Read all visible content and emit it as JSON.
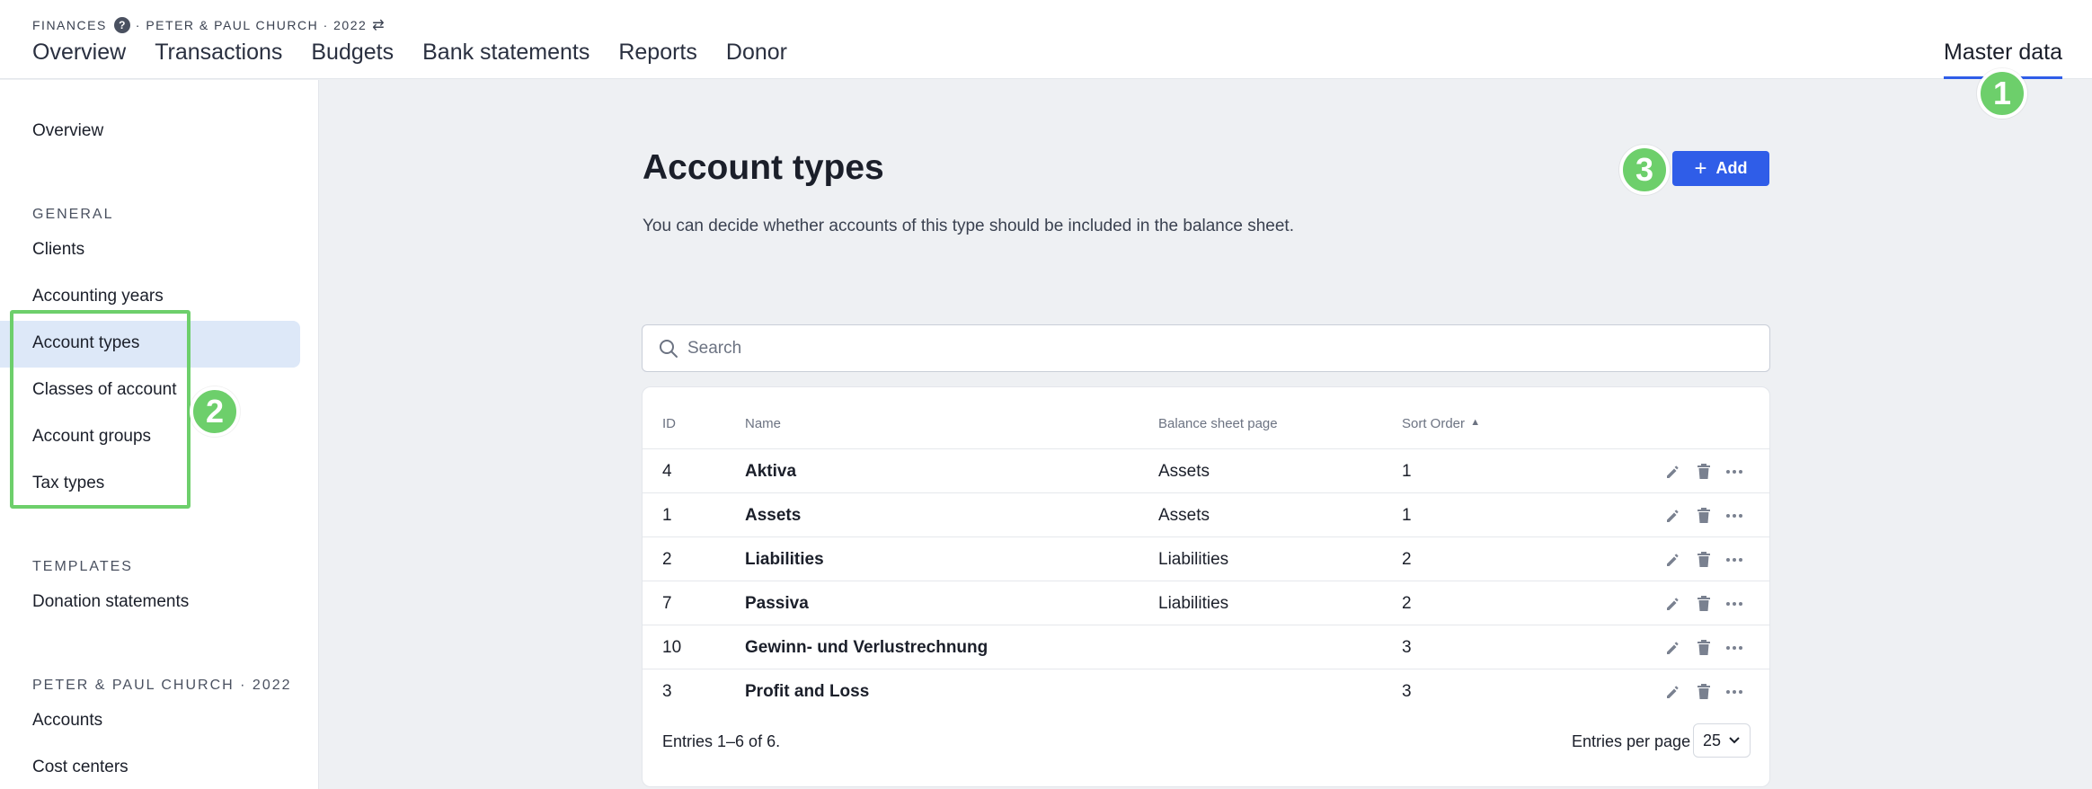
{
  "header": {
    "breadcrumb_app": "FINANCES",
    "breadcrumb_help": "?",
    "breadcrumb_context": "· PETER & PAUL CHURCH · 2022",
    "nav": [
      "Overview",
      "Transactions",
      "Budgets",
      "Bank statements",
      "Reports",
      "Donor"
    ],
    "master_data": "Master data"
  },
  "callouts": [
    "1",
    "2",
    "3"
  ],
  "sidebar": {
    "overview": "Overview",
    "general_heading": "GENERAL",
    "general_items": [
      "Clients",
      "Accounting years",
      "Account types",
      "Classes of account",
      "Account groups",
      "Tax types"
    ],
    "active_item": "Account types",
    "templates_heading": "TEMPLATES",
    "templates_items": [
      "Donation statements"
    ],
    "org_heading": "PETER & PAUL CHURCH · 2022",
    "org_items": [
      "Accounts",
      "Cost centers"
    ]
  },
  "main": {
    "title": "Account types",
    "description": "You can decide whether accounts of this type should be included in the balance sheet.",
    "add_label": "Add",
    "search_placeholder": "Search",
    "columns": {
      "id": "ID",
      "name": "Name",
      "balance": "Balance sheet page",
      "sort": "Sort Order"
    },
    "rows": [
      {
        "id": "4",
        "name": "Aktiva",
        "balance": "Assets",
        "sort": "1"
      },
      {
        "id": "1",
        "name": "Assets",
        "balance": "Assets",
        "sort": "1"
      },
      {
        "id": "2",
        "name": "Liabilities",
        "balance": "Liabilities",
        "sort": "2"
      },
      {
        "id": "7",
        "name": "Passiva",
        "balance": "Liabilities",
        "sort": "2"
      },
      {
        "id": "10",
        "name": "Gewinn- und Verlustrechnung",
        "balance": "",
        "sort": "3"
      },
      {
        "id": "3",
        "name": "Profit and Loss",
        "balance": "",
        "sort": "3"
      }
    ],
    "entries_text": "Entries 1–6 of 6.",
    "per_page_label": "Entries per page",
    "per_page_value": "25"
  },
  "colors": {
    "accent": "#2f5de8",
    "callout": "#6dcf6b",
    "active_bg": "#dde8f8"
  }
}
